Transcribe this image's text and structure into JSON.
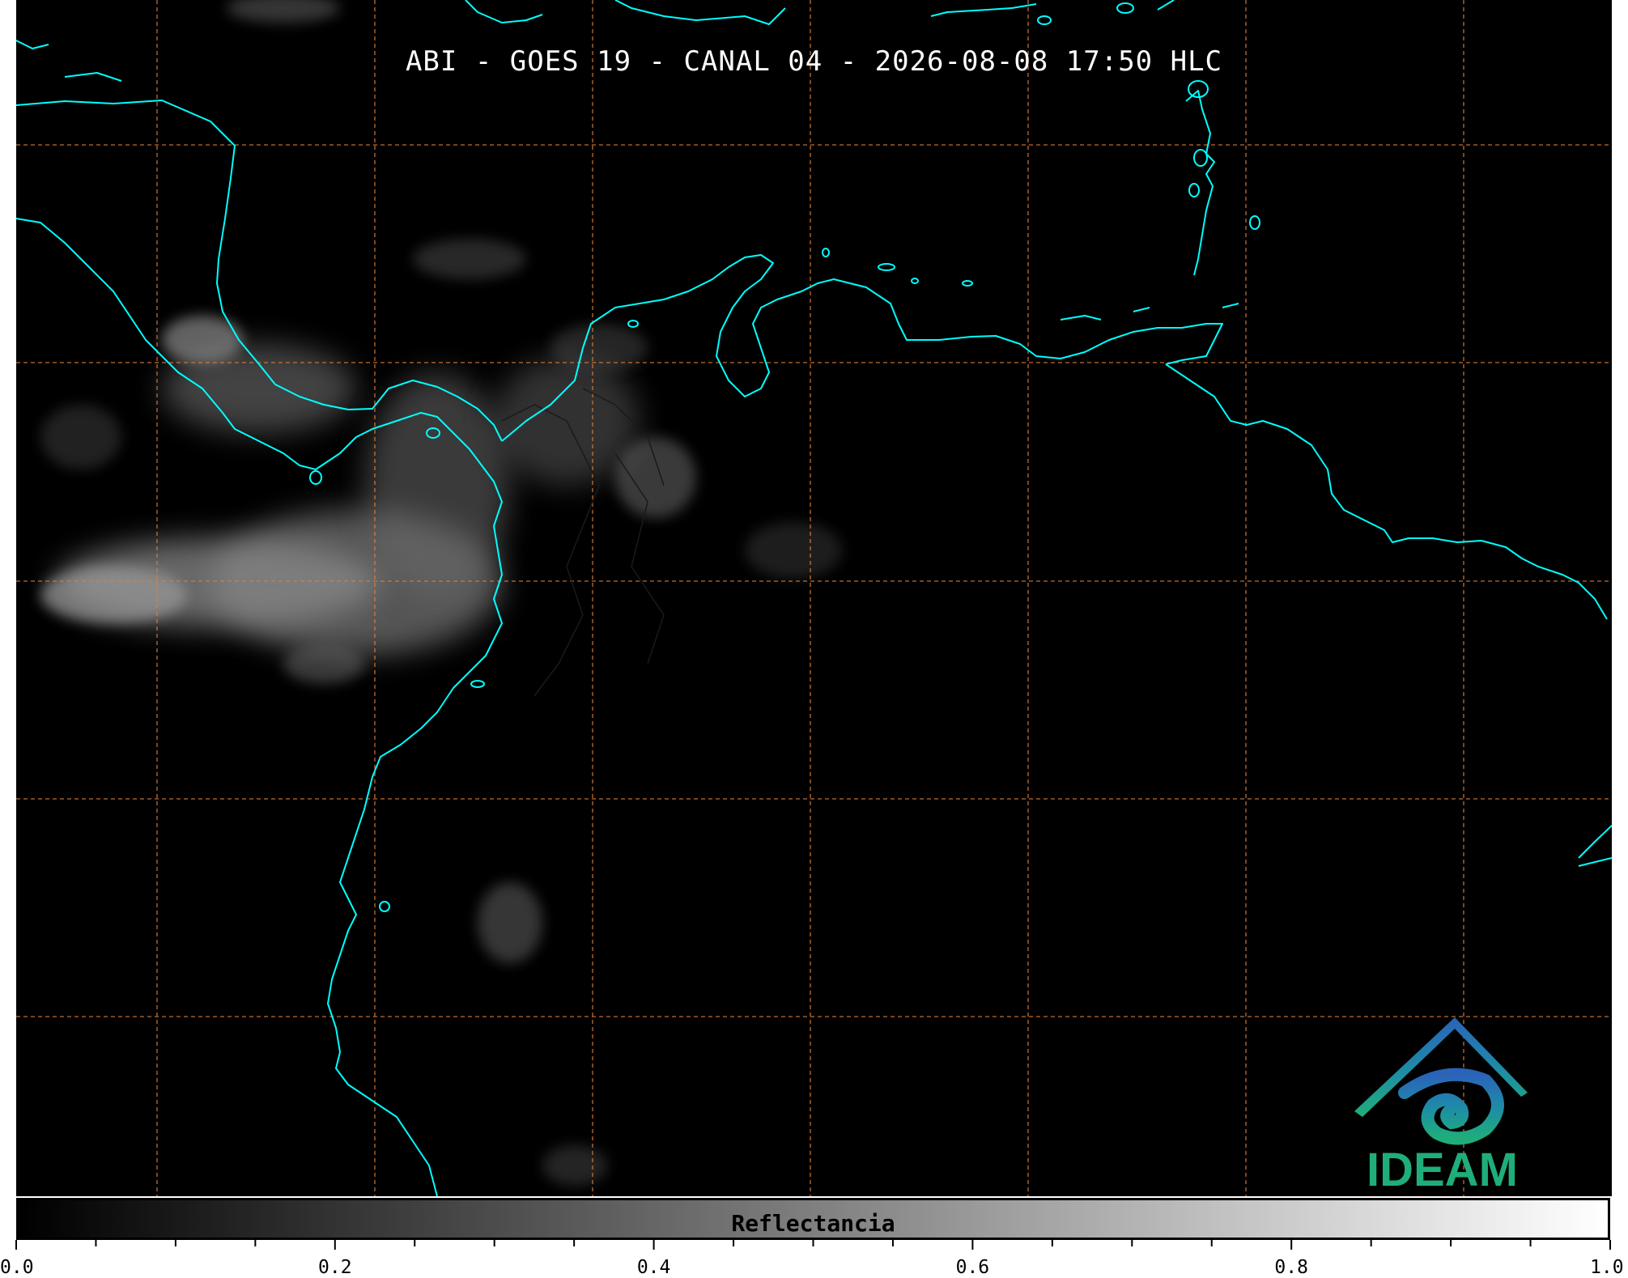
{
  "title": "ABI - GOES 19 - CANAL 04 - 2026-08-08 17:50 HLC",
  "colorbar": {
    "label": "Reflectancia",
    "min": 0.0,
    "max": 1.0,
    "tick_labels": [
      "0.0",
      "0.2",
      "0.4",
      "0.6",
      "0.8",
      "1.0"
    ],
    "tick_values": [
      0.0,
      0.2,
      0.4,
      0.6,
      0.8,
      1.0
    ],
    "minor_step": 0.05,
    "start_color": "#000000",
    "end_color": "#ffffff"
  },
  "logo": {
    "text": "IDEAM",
    "color": "#1fae7a",
    "icon": "ideam-mountain-spiral-icon"
  },
  "colors": {
    "coastline": "#00ffff",
    "grid": "#e0803a",
    "borders": "#111111",
    "background": "#000000"
  }
}
